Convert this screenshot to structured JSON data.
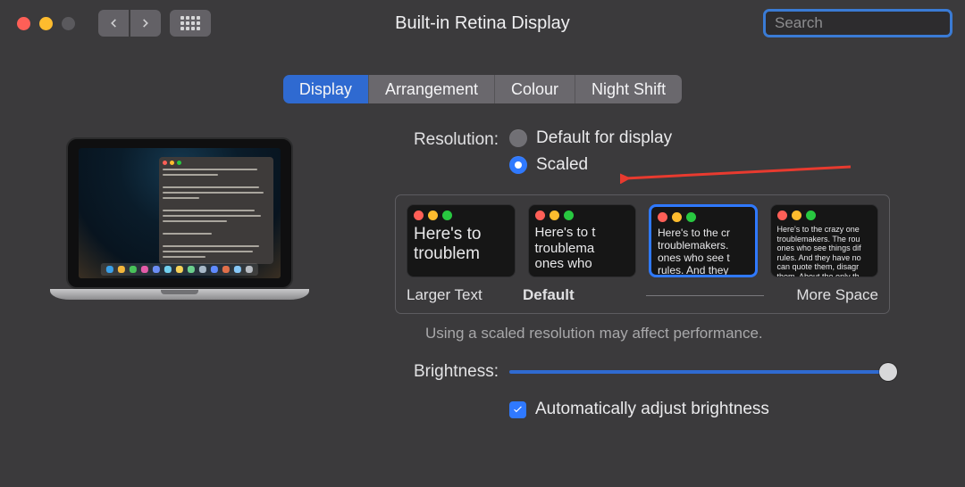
{
  "window": {
    "title": "Built-in Retina Display"
  },
  "traffic": {
    "close": "#ff5f57",
    "min": "#febc2e",
    "max": "#5a595d"
  },
  "search": {
    "placeholder": "Search",
    "value": ""
  },
  "tabs": [
    {
      "label": "Display",
      "active": true
    },
    {
      "label": "Arrangement",
      "active": false
    },
    {
      "label": "Colour",
      "active": false
    },
    {
      "label": "Night Shift",
      "active": false
    }
  ],
  "resolution": {
    "label": "Resolution:",
    "options": [
      {
        "label": "Default for display",
        "selected": false
      },
      {
        "label": "Scaled",
        "selected": true
      }
    ],
    "arrow_color": "#e83a2f"
  },
  "scale": {
    "previews": [
      {
        "font_px": 19,
        "text": "Here's to\ntroublem",
        "selected": false
      },
      {
        "font_px": 15,
        "text": "Here's to t\ntroublema\nones who",
        "selected": false
      },
      {
        "font_px": 12,
        "text": "Here's to the cr\ntroublemakers.\nones who see t\nrules. And they",
        "selected": true
      },
      {
        "font_px": 9,
        "text": "Here's to the crazy one\ntroublemakers. The rou\nones who see things dif\nrules. And they have no\ncan quote them, disagr\nthem. About the only th\nBecause they change t",
        "selected": false
      }
    ],
    "labels": {
      "left": "Larger Text",
      "mid": "Default",
      "right": "More Space"
    },
    "warning": "Using a scaled resolution may affect performance."
  },
  "brightness": {
    "label": "Brightness:",
    "value": 100
  },
  "auto_brightness": {
    "checked": true,
    "label": "Automatically adjust brightness"
  },
  "dock_colors": [
    "#3aa0e8",
    "#f3b63b",
    "#48c25a",
    "#e35ca8",
    "#6b8ef5",
    "#71d1f0",
    "#f6d258",
    "#6bcf8d",
    "#a7b8c7",
    "#5f8aff",
    "#e06f4a",
    "#87c8f7",
    "#b7bcc2"
  ],
  "ptl": {
    "r": "#ff5f57",
    "y": "#febc2e",
    "g": "#28c840"
  }
}
